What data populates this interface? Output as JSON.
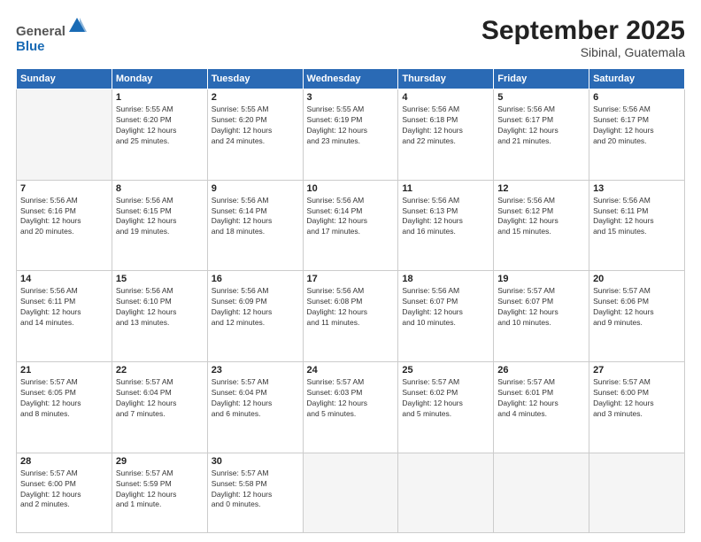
{
  "header": {
    "logo_line1": "General",
    "logo_line2": "Blue",
    "month_title": "September 2025",
    "location": "Sibinal, Guatemala"
  },
  "days_of_week": [
    "Sunday",
    "Monday",
    "Tuesday",
    "Wednesday",
    "Thursday",
    "Friday",
    "Saturday"
  ],
  "weeks": [
    [
      {
        "num": "",
        "info": ""
      },
      {
        "num": "1",
        "info": "Sunrise: 5:55 AM\nSunset: 6:20 PM\nDaylight: 12 hours\nand 25 minutes."
      },
      {
        "num": "2",
        "info": "Sunrise: 5:55 AM\nSunset: 6:20 PM\nDaylight: 12 hours\nand 24 minutes."
      },
      {
        "num": "3",
        "info": "Sunrise: 5:55 AM\nSunset: 6:19 PM\nDaylight: 12 hours\nand 23 minutes."
      },
      {
        "num": "4",
        "info": "Sunrise: 5:56 AM\nSunset: 6:18 PM\nDaylight: 12 hours\nand 22 minutes."
      },
      {
        "num": "5",
        "info": "Sunrise: 5:56 AM\nSunset: 6:17 PM\nDaylight: 12 hours\nand 21 minutes."
      },
      {
        "num": "6",
        "info": "Sunrise: 5:56 AM\nSunset: 6:17 PM\nDaylight: 12 hours\nand 20 minutes."
      }
    ],
    [
      {
        "num": "7",
        "info": "Sunrise: 5:56 AM\nSunset: 6:16 PM\nDaylight: 12 hours\nand 20 minutes."
      },
      {
        "num": "8",
        "info": "Sunrise: 5:56 AM\nSunset: 6:15 PM\nDaylight: 12 hours\nand 19 minutes."
      },
      {
        "num": "9",
        "info": "Sunrise: 5:56 AM\nSunset: 6:14 PM\nDaylight: 12 hours\nand 18 minutes."
      },
      {
        "num": "10",
        "info": "Sunrise: 5:56 AM\nSunset: 6:14 PM\nDaylight: 12 hours\nand 17 minutes."
      },
      {
        "num": "11",
        "info": "Sunrise: 5:56 AM\nSunset: 6:13 PM\nDaylight: 12 hours\nand 16 minutes."
      },
      {
        "num": "12",
        "info": "Sunrise: 5:56 AM\nSunset: 6:12 PM\nDaylight: 12 hours\nand 15 minutes."
      },
      {
        "num": "13",
        "info": "Sunrise: 5:56 AM\nSunset: 6:11 PM\nDaylight: 12 hours\nand 15 minutes."
      }
    ],
    [
      {
        "num": "14",
        "info": "Sunrise: 5:56 AM\nSunset: 6:11 PM\nDaylight: 12 hours\nand 14 minutes."
      },
      {
        "num": "15",
        "info": "Sunrise: 5:56 AM\nSunset: 6:10 PM\nDaylight: 12 hours\nand 13 minutes."
      },
      {
        "num": "16",
        "info": "Sunrise: 5:56 AM\nSunset: 6:09 PM\nDaylight: 12 hours\nand 12 minutes."
      },
      {
        "num": "17",
        "info": "Sunrise: 5:56 AM\nSunset: 6:08 PM\nDaylight: 12 hours\nand 11 minutes."
      },
      {
        "num": "18",
        "info": "Sunrise: 5:56 AM\nSunset: 6:07 PM\nDaylight: 12 hours\nand 10 minutes."
      },
      {
        "num": "19",
        "info": "Sunrise: 5:57 AM\nSunset: 6:07 PM\nDaylight: 12 hours\nand 10 minutes."
      },
      {
        "num": "20",
        "info": "Sunrise: 5:57 AM\nSunset: 6:06 PM\nDaylight: 12 hours\nand 9 minutes."
      }
    ],
    [
      {
        "num": "21",
        "info": "Sunrise: 5:57 AM\nSunset: 6:05 PM\nDaylight: 12 hours\nand 8 minutes."
      },
      {
        "num": "22",
        "info": "Sunrise: 5:57 AM\nSunset: 6:04 PM\nDaylight: 12 hours\nand 7 minutes."
      },
      {
        "num": "23",
        "info": "Sunrise: 5:57 AM\nSunset: 6:04 PM\nDaylight: 12 hours\nand 6 minutes."
      },
      {
        "num": "24",
        "info": "Sunrise: 5:57 AM\nSunset: 6:03 PM\nDaylight: 12 hours\nand 5 minutes."
      },
      {
        "num": "25",
        "info": "Sunrise: 5:57 AM\nSunset: 6:02 PM\nDaylight: 12 hours\nand 5 minutes."
      },
      {
        "num": "26",
        "info": "Sunrise: 5:57 AM\nSunset: 6:01 PM\nDaylight: 12 hours\nand 4 minutes."
      },
      {
        "num": "27",
        "info": "Sunrise: 5:57 AM\nSunset: 6:00 PM\nDaylight: 12 hours\nand 3 minutes."
      }
    ],
    [
      {
        "num": "28",
        "info": "Sunrise: 5:57 AM\nSunset: 6:00 PM\nDaylight: 12 hours\nand 2 minutes."
      },
      {
        "num": "29",
        "info": "Sunrise: 5:57 AM\nSunset: 5:59 PM\nDaylight: 12 hours\nand 1 minute."
      },
      {
        "num": "30",
        "info": "Sunrise: 5:57 AM\nSunset: 5:58 PM\nDaylight: 12 hours\nand 0 minutes."
      },
      {
        "num": "",
        "info": ""
      },
      {
        "num": "",
        "info": ""
      },
      {
        "num": "",
        "info": ""
      },
      {
        "num": "",
        "info": ""
      }
    ]
  ]
}
